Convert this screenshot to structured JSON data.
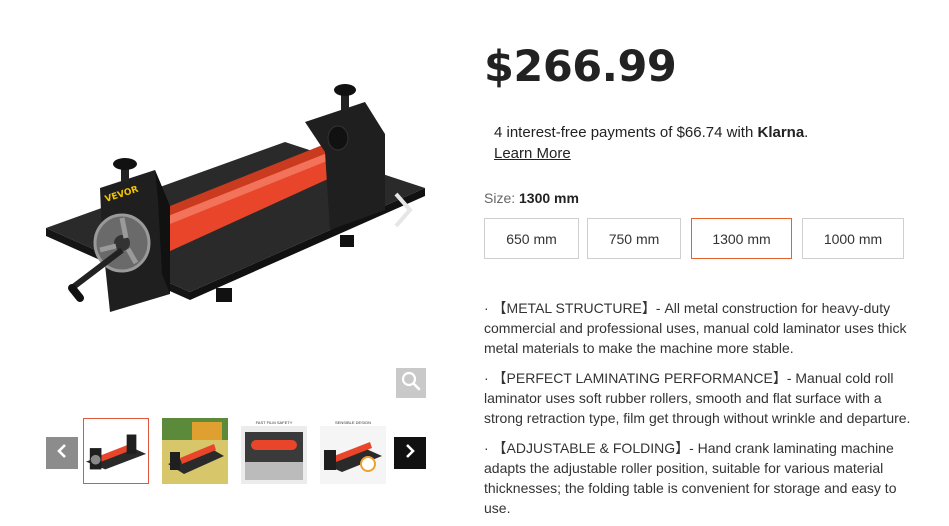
{
  "gallery": {
    "brand_mark": "VEVOR",
    "thumbnail_banner_3": "FAST FILM SAFETY",
    "thumbnail_banner_4": "SENSIBLE DESIGN"
  },
  "product": {
    "price": "$266.99"
  },
  "klarna": {
    "prefix": "4 interest-free payments of $66.74 with ",
    "brand": "Klarna",
    "suffix": ".",
    "learn_more": "Learn More"
  },
  "size": {
    "label": "Size:",
    "selected": "1300 mm",
    "options": [
      "650 mm",
      "750 mm",
      "1300 mm",
      "1000 mm"
    ]
  },
  "features": [
    "· 【METAL STRUCTURE】- All metal construction for heavy-duty commercial and professional uses, manual cold laminator uses thick metal materials to make the machine more stable.",
    "· 【PERFECT LAMINATING PERFORMANCE】- Manual cold roll laminator uses soft rubber rollers, smooth and flat surface with a strong retraction type, film get through without wrinkle and departure.",
    "· 【ADJUSTABLE & FOLDING】- Hand crank laminating machine adapts the adjustable roller position, suitable for various material thicknesses; the folding table is convenient for storage and easy to use."
  ],
  "colors": {
    "selected_border": "#e5622f",
    "roller": "#e8452a",
    "machine_body": "#1f1f1f"
  }
}
